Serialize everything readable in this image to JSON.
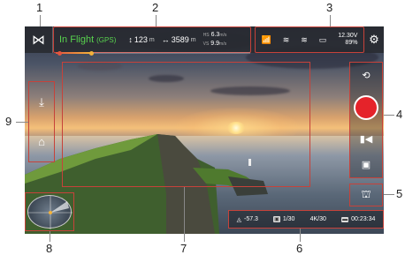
{
  "callouts": [
    "1",
    "2",
    "3",
    "4",
    "5",
    "6",
    "7",
    "8",
    "9"
  ],
  "top_bar": {
    "home_icon": "home-logo-icon",
    "flight_status": "In Flight",
    "flight_mode": "(GPS)",
    "height_value": "123",
    "height_unit": "m",
    "distance_value": "3589",
    "distance_unit": "m",
    "hs_label": "HS",
    "hs_value": "6.3",
    "hs_unit": "m/s",
    "vs_label": "VS",
    "vs_value": "9.9",
    "vs_unit": "m/s",
    "battery_voltage": "12.30V",
    "battery_percent": "89%",
    "settings_icon": "gear-icon"
  },
  "bottom_status": {
    "ev": "-57.3",
    "shutter": "1/30",
    "resolution": "4K/30",
    "time": "00:23:34"
  },
  "colors": {
    "accent": "#c7423a",
    "record": "#e5232a",
    "status_green": "#58d24e"
  }
}
